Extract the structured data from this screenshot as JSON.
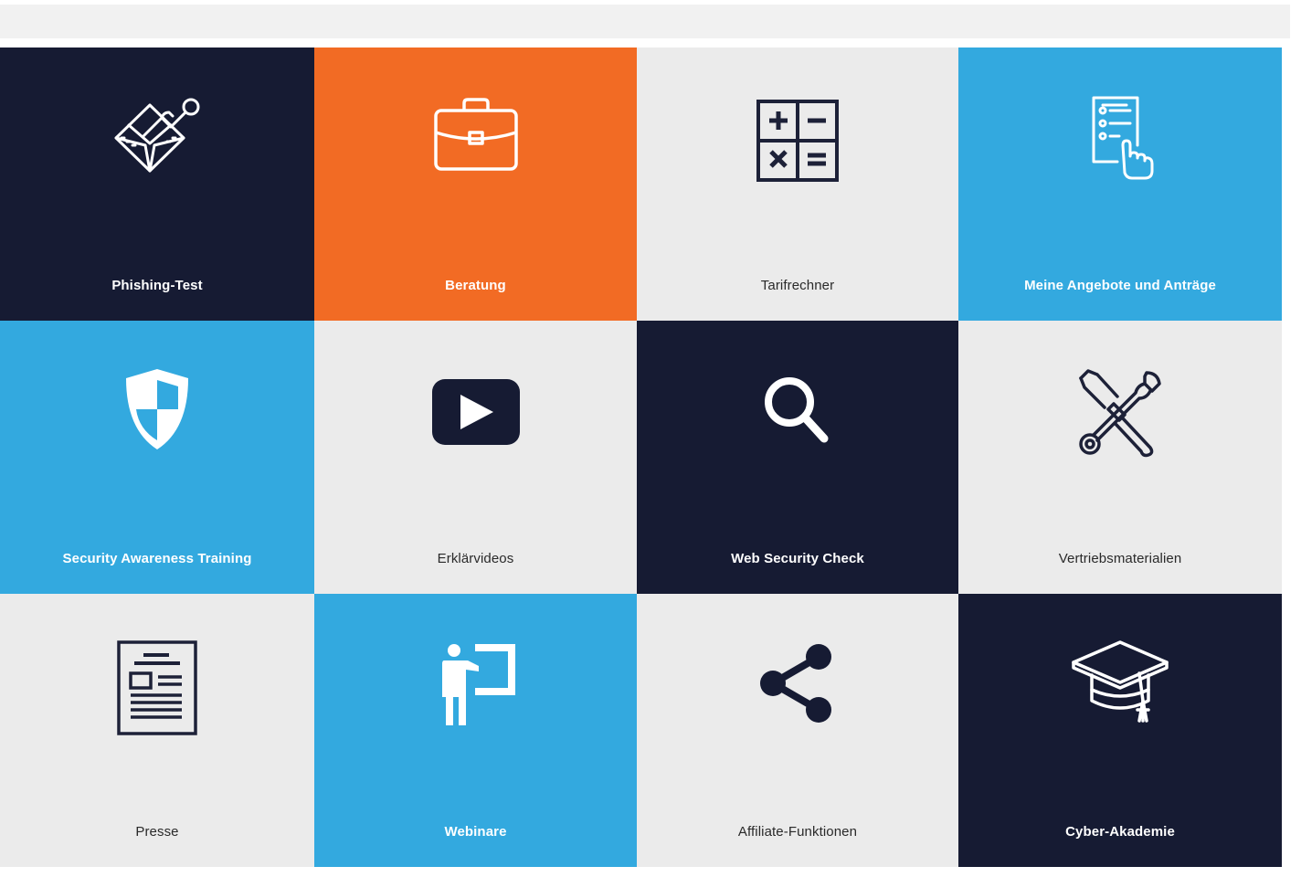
{
  "tiles": [
    {
      "label": "Phishing-Test",
      "icon": "phishing-envelope-icon",
      "theme": "navy"
    },
    {
      "label": "Beratung",
      "icon": "briefcase-icon",
      "theme": "orange"
    },
    {
      "label": "Tarifrechner",
      "icon": "calculator-icon",
      "theme": "light"
    },
    {
      "label": "Meine Angebote und Anträge",
      "icon": "checklist-hand-icon",
      "theme": "blue"
    },
    {
      "label": "Security Awareness Training",
      "icon": "shield-icon",
      "theme": "blue"
    },
    {
      "label": "Erklärvideos",
      "icon": "play-video-icon",
      "theme": "light"
    },
    {
      "label": "Web Security Check",
      "icon": "magnifier-icon",
      "theme": "navy"
    },
    {
      "label": "Vertriebsmaterialien",
      "icon": "wrench-screwdriver-icon",
      "theme": "light"
    },
    {
      "label": "Presse",
      "icon": "newspaper-icon",
      "theme": "light"
    },
    {
      "label": "Webinare",
      "icon": "presenter-board-icon",
      "theme": "blue"
    },
    {
      "label": "Affiliate-Funktionen",
      "icon": "share-icon",
      "theme": "light"
    },
    {
      "label": "Cyber-Akademie",
      "icon": "graduation-cap-icon",
      "theme": "navy"
    }
  ],
  "colors": {
    "navy": "#161b33",
    "orange": "#f26b24",
    "blue": "#33a9df",
    "light": "#ebebeb"
  }
}
